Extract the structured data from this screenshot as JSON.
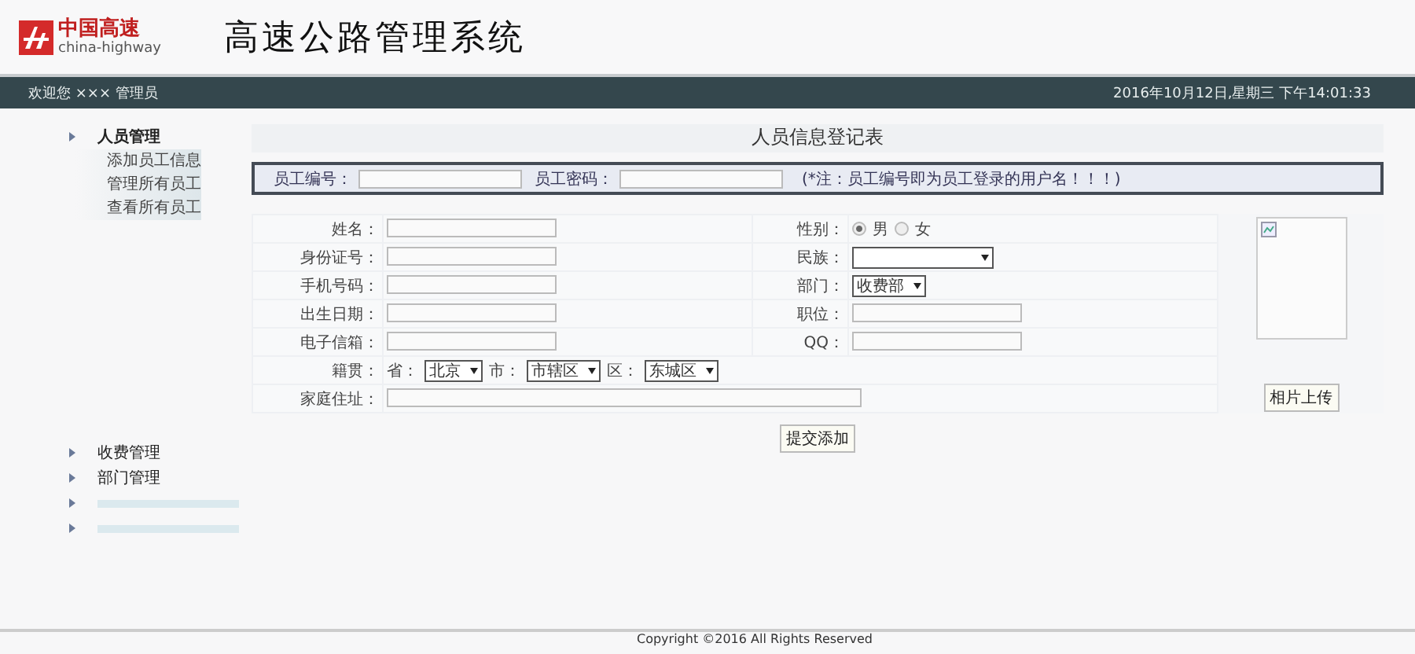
{
  "header": {
    "logo_cn": "中国高速",
    "logo_en": "china-highway",
    "title": "高速公路管理系统"
  },
  "nav": {
    "welcome": "欢迎您 ××× 管理员",
    "datetime": "2016年10月12日,星期三 下午14:01:33"
  },
  "sidebar": [
    {
      "kind": "menu",
      "label": "人员管理",
      "children": [
        "添加员工信息",
        "管理所有员工",
        "查看所有员工"
      ]
    },
    {
      "kind": "menu",
      "label": "收费管理"
    },
    {
      "kind": "menu",
      "label": "部门管理"
    },
    {
      "kind": "blank"
    },
    {
      "kind": "blank"
    }
  ],
  "form": {
    "title": "人员信息登记表",
    "account": {
      "id_label": "员工编号：",
      "pwd_label": "员工密码：",
      "note": "(*注：员工编号即为员工登录的用户名！！！)"
    },
    "rows": [
      {
        "fields": [
          {
            "label": "姓名：",
            "kind": "input"
          },
          {
            "label": "性别：",
            "kind": "radio",
            "options": [
              {
                "label": "男",
                "selected": true
              },
              {
                "label": "女",
                "selected": false
              }
            ]
          }
        ]
      },
      {
        "fields": [
          {
            "label": "身份证号：",
            "kind": "input"
          },
          {
            "label": "民族：",
            "kind": "select"
          }
        ]
      },
      {
        "fields": [
          {
            "label": "手机号码：",
            "kind": "input"
          },
          {
            "label": "部门：",
            "kind": "select",
            "value": "收费部"
          }
        ]
      },
      {
        "fields": [
          {
            "label": "出生日期：",
            "kind": "input"
          },
          {
            "label": "职位：",
            "kind": "input"
          }
        ]
      },
      {
        "fields": [
          {
            "label": "电子信箱：",
            "kind": "input"
          },
          {
            "label": "QQ：",
            "kind": "input"
          }
        ]
      },
      {
        "fields": [
          {
            "label": "籍贯：",
            "kind": "region",
            "parts": [
              {
                "label": "省：",
                "value": "北京"
              },
              {
                "label": "市：",
                "value": "市辖区"
              },
              {
                "label": "区：",
                "value": "东城区"
              }
            ]
          }
        ]
      },
      {
        "fields": [
          {
            "label": "家庭住址：",
            "kind": "wide"
          }
        ]
      }
    ],
    "photo_button": "相片上传",
    "submit": "提交添加"
  },
  "footer": "Copyright ©2016 All Rights Reserved"
}
